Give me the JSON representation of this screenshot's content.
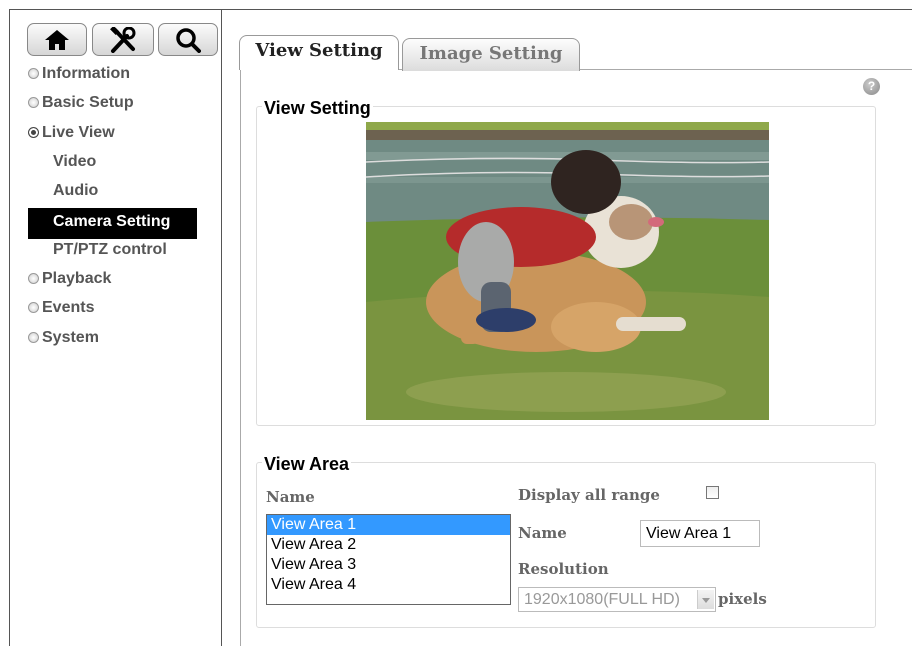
{
  "toolbar": {
    "icons": [
      "home-icon",
      "tools-icon",
      "search-icon"
    ]
  },
  "sidebar": {
    "items": [
      {
        "label": "Information"
      },
      {
        "label": "Basic Setup"
      },
      {
        "label": "Live View"
      },
      {
        "label": "Video"
      },
      {
        "label": "Audio"
      },
      {
        "label": "Camera Setting"
      },
      {
        "label": "PT/PTZ control"
      },
      {
        "label": "Playback"
      },
      {
        "label": "Events"
      },
      {
        "label": "System"
      }
    ]
  },
  "tabs": [
    {
      "label": "View Setting"
    },
    {
      "label": "Image Setting"
    }
  ],
  "help": {
    "label": "?"
  },
  "view_setting": {
    "legend": "View Setting"
  },
  "view_area": {
    "legend": "View Area",
    "name_header": "Name",
    "areas": [
      "View Area 1",
      "View Area 2",
      "View Area 3",
      "View Area 4"
    ],
    "display_all_label": "Display all range",
    "name_label": "Name",
    "name_value": "View Area 1",
    "resolution_label": "Resolution",
    "resolution_value": "1920x1080(FULL HD)",
    "resolution_unit": "pixels"
  },
  "colors": {
    "selection": "#3399ff",
    "active_nav": "#000000"
  }
}
